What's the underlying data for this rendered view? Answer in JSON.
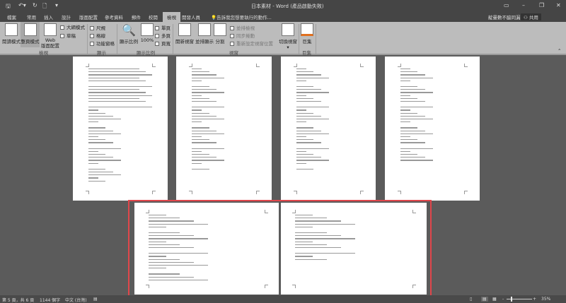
{
  "title": "日本素材 - Word (產品啟動失敗)",
  "user": "靛曼數不脇同漏",
  "share_label": "共用",
  "tabs": [
    "檔案",
    "常用",
    "插入",
    "設計",
    "版面配置",
    "參考資料",
    "郵件",
    "校閱",
    "檢視",
    "開發人員"
  ],
  "tell_me": "告訴我您想要執行的動作...",
  "ribbon": {
    "views": {
      "read": "閱讀模式",
      "print": "整頁模式",
      "web": "Web\n版面配置",
      "outline": "大綱模式",
      "draft": "草稿",
      "group": "檢視"
    },
    "show": {
      "ruler": "尺規",
      "grid": "格線",
      "nav": "功能窗格",
      "group": "顯示"
    },
    "zoom": {
      "zoom": "顯示比例",
      "hundred": "100%",
      "one": "單頁",
      "multi": "多頁",
      "width": "頁寬",
      "group": "顯示比例"
    },
    "window": {
      "new": "開新視窗",
      "arrange": "並排顯示",
      "split": "分割",
      "side": "並排檢視",
      "sync": "同步捲動",
      "reset": "重新設定視窗位置",
      "switch": "切換視窗",
      "group": "視窗"
    },
    "macros": {
      "macros": "巨集",
      "group": "巨集"
    }
  },
  "status": {
    "page": "第 5 頁，共 6 頁",
    "words": "1144 個字",
    "lang": "中文 (台灣)",
    "zoom": "35%"
  }
}
